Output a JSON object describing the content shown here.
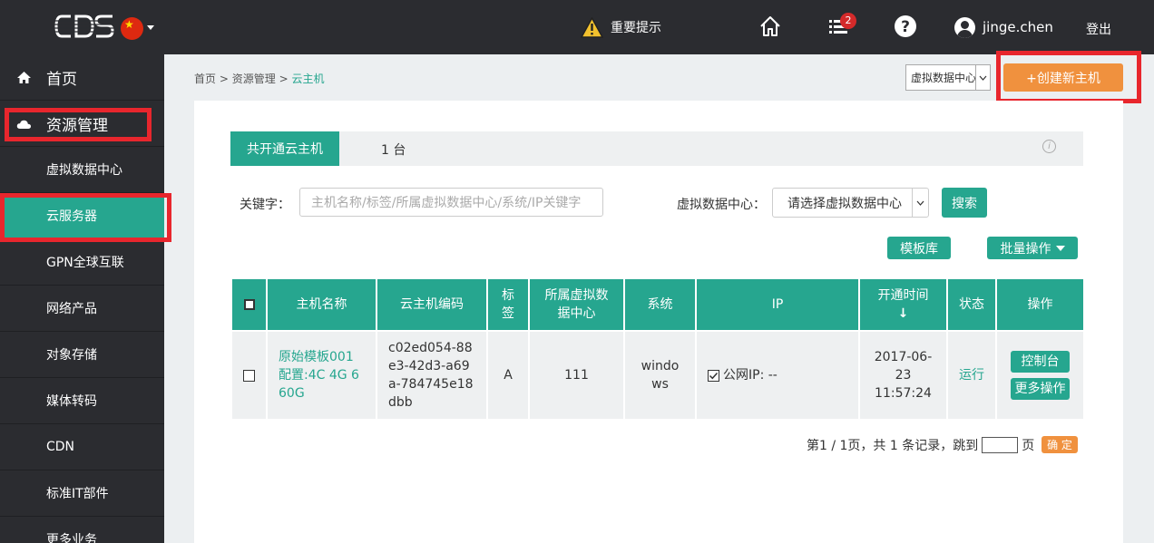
{
  "topbar": {
    "logo_text": "CDS",
    "notice": "重要提示",
    "badge_count": "2",
    "username": "jinge.chen",
    "logout": "登出"
  },
  "sidebar": {
    "items": [
      {
        "label": "首页",
        "icon": "home-icon"
      },
      {
        "label": "资源管理",
        "icon": "cloud-icon"
      },
      {
        "label": "虚拟数据中心"
      },
      {
        "label": "云服务器"
      },
      {
        "label": "GPN全球互联"
      },
      {
        "label": "网络产品"
      },
      {
        "label": "对象存储"
      },
      {
        "label": "媒体转码"
      },
      {
        "label": "CDN"
      },
      {
        "label": "标准IT部件"
      },
      {
        "label": "更多业务"
      }
    ]
  },
  "breadcrumb": {
    "home": "首页",
    "sep1": ">",
    "resource": "资源管理",
    "sep2": ">",
    "current": "云主机"
  },
  "header": {
    "dc_select": "虚拟数据中心",
    "create_button": "+创建新主机"
  },
  "tabs": {
    "active": "共开通云主机",
    "count": "1 台"
  },
  "filters": {
    "keyword_label": "关键字：",
    "keyword_placeholder": "主机名称/标签/所属虚拟数据中心/系统/IP关键字",
    "dc_label": "虚拟数据中心：",
    "dc_value": "请选择虚拟数据中心",
    "search_button": "搜索",
    "template_button": "模板库",
    "batch_button": "批量操作"
  },
  "table": {
    "headers": {
      "name": "主机名称",
      "code": "云主机编码",
      "tag": "标签",
      "dc": "所属虚拟数据中心",
      "os": "系统",
      "ip": "IP",
      "time": "开通时间",
      "sort_arrow": "↓",
      "status": "状态",
      "ops": "操作"
    },
    "rows": [
      {
        "name": "原始模板001",
        "config": "配置:4C 4G 660G",
        "code": "c02ed054-88e3-42d3-a69a-784745e18dbb",
        "tag": "A",
        "dc": "111",
        "os": "windows",
        "ip": "公网IP: --",
        "time": "2017-06-23 11:57:24",
        "status": "运行",
        "console_button": "控制台",
        "more_button": "更多操作"
      }
    ]
  },
  "pager": {
    "text": "第1 / 1页，共 1 条记录，跳到",
    "page_unit": "页",
    "ok_button": "确 定"
  },
  "colors": {
    "accent": "#26a68f",
    "orange": "#f0913e",
    "dark": "#2b2c30",
    "highlight": "#e8262d"
  }
}
